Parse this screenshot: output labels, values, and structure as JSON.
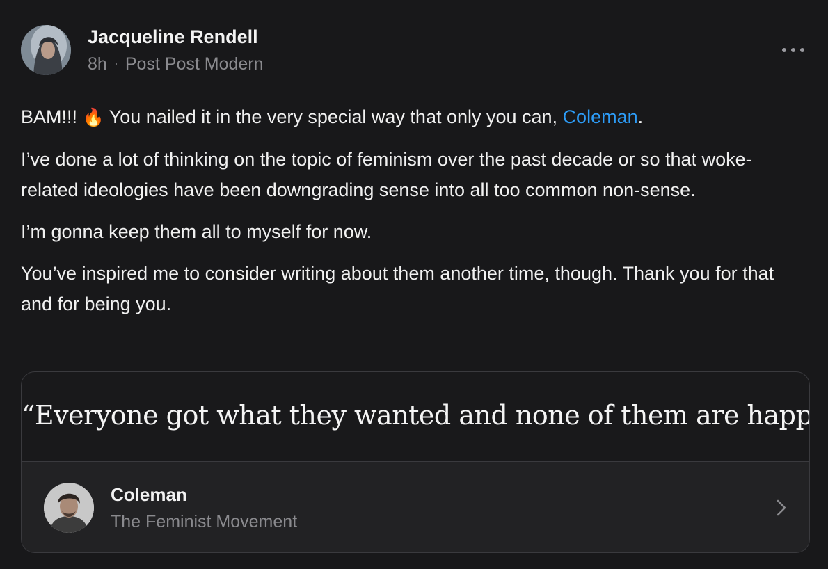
{
  "post": {
    "author": "Jacqueline Rendell",
    "time": "8h",
    "separator": "·",
    "publication": "Post Post Modern",
    "paragraphs": [
      {
        "before": "BAM!!! ",
        "emoji": "🔥",
        "after": " You nailed it in the very special way that only you can, ",
        "mention": "Coleman",
        "end": "."
      },
      {
        "text": "I’ve done a lot of thinking on the topic of feminism over the past decade or so that woke-related ideologies have been downgrading sense into all too common non-sense."
      },
      {
        "text": "I’m gonna keep them all to myself for now."
      },
      {
        "text": "You’ve inspired me to consider writing about them another time, though. Thank you for that and for being you."
      }
    ]
  },
  "quote": {
    "text": "“Everyone got what they wanted and none of them are happy.”",
    "author": "Coleman",
    "source": "The Feminist Movement"
  },
  "icons": {
    "more": "more-horizontal-icon",
    "chevron": "chevron-right-icon",
    "fire": "fire-emoji"
  },
  "colors": {
    "background": "#18181a",
    "mention": "#2d9cf7",
    "muted": "#8a8a8e",
    "card_footer": "#222224"
  }
}
